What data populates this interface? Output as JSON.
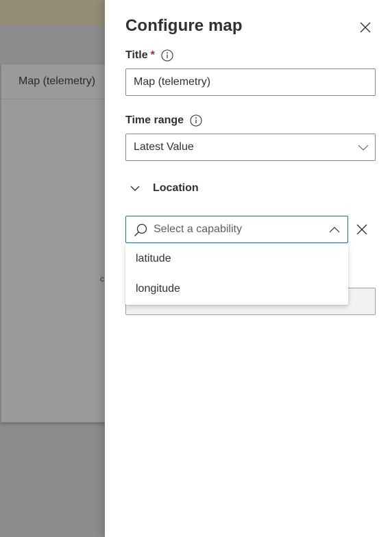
{
  "background": {
    "tile_title": "Map (telemetry)",
    "tile_stub_text": "c"
  },
  "panel": {
    "title": "Configure map",
    "close_icon": "close-icon",
    "title_field": {
      "label": "Title",
      "required_marker": "*",
      "info_icon": "info-icon",
      "value": "Map (telemetry)"
    },
    "time_range": {
      "label": "Time range",
      "info_icon": "info-icon",
      "selected": "Latest Value",
      "chevron_icon": "chevron-down-icon"
    },
    "location_section": {
      "label": "Location",
      "expanded": true,
      "chevron_icon": "chevron-down-icon"
    },
    "capability_combo": {
      "placeholder": "Select a capability",
      "value": "",
      "search_icon": "search-icon",
      "chevron_icon": "chevron-up-icon",
      "remove_icon": "close-icon",
      "options": [
        {
          "label": "latitude"
        },
        {
          "label": "longitude"
        }
      ]
    }
  },
  "colors": {
    "accent": "#0078d4",
    "required": "#a4262c",
    "text": "#323130",
    "placeholder": "#605e5c",
    "border": "#8a8886"
  }
}
